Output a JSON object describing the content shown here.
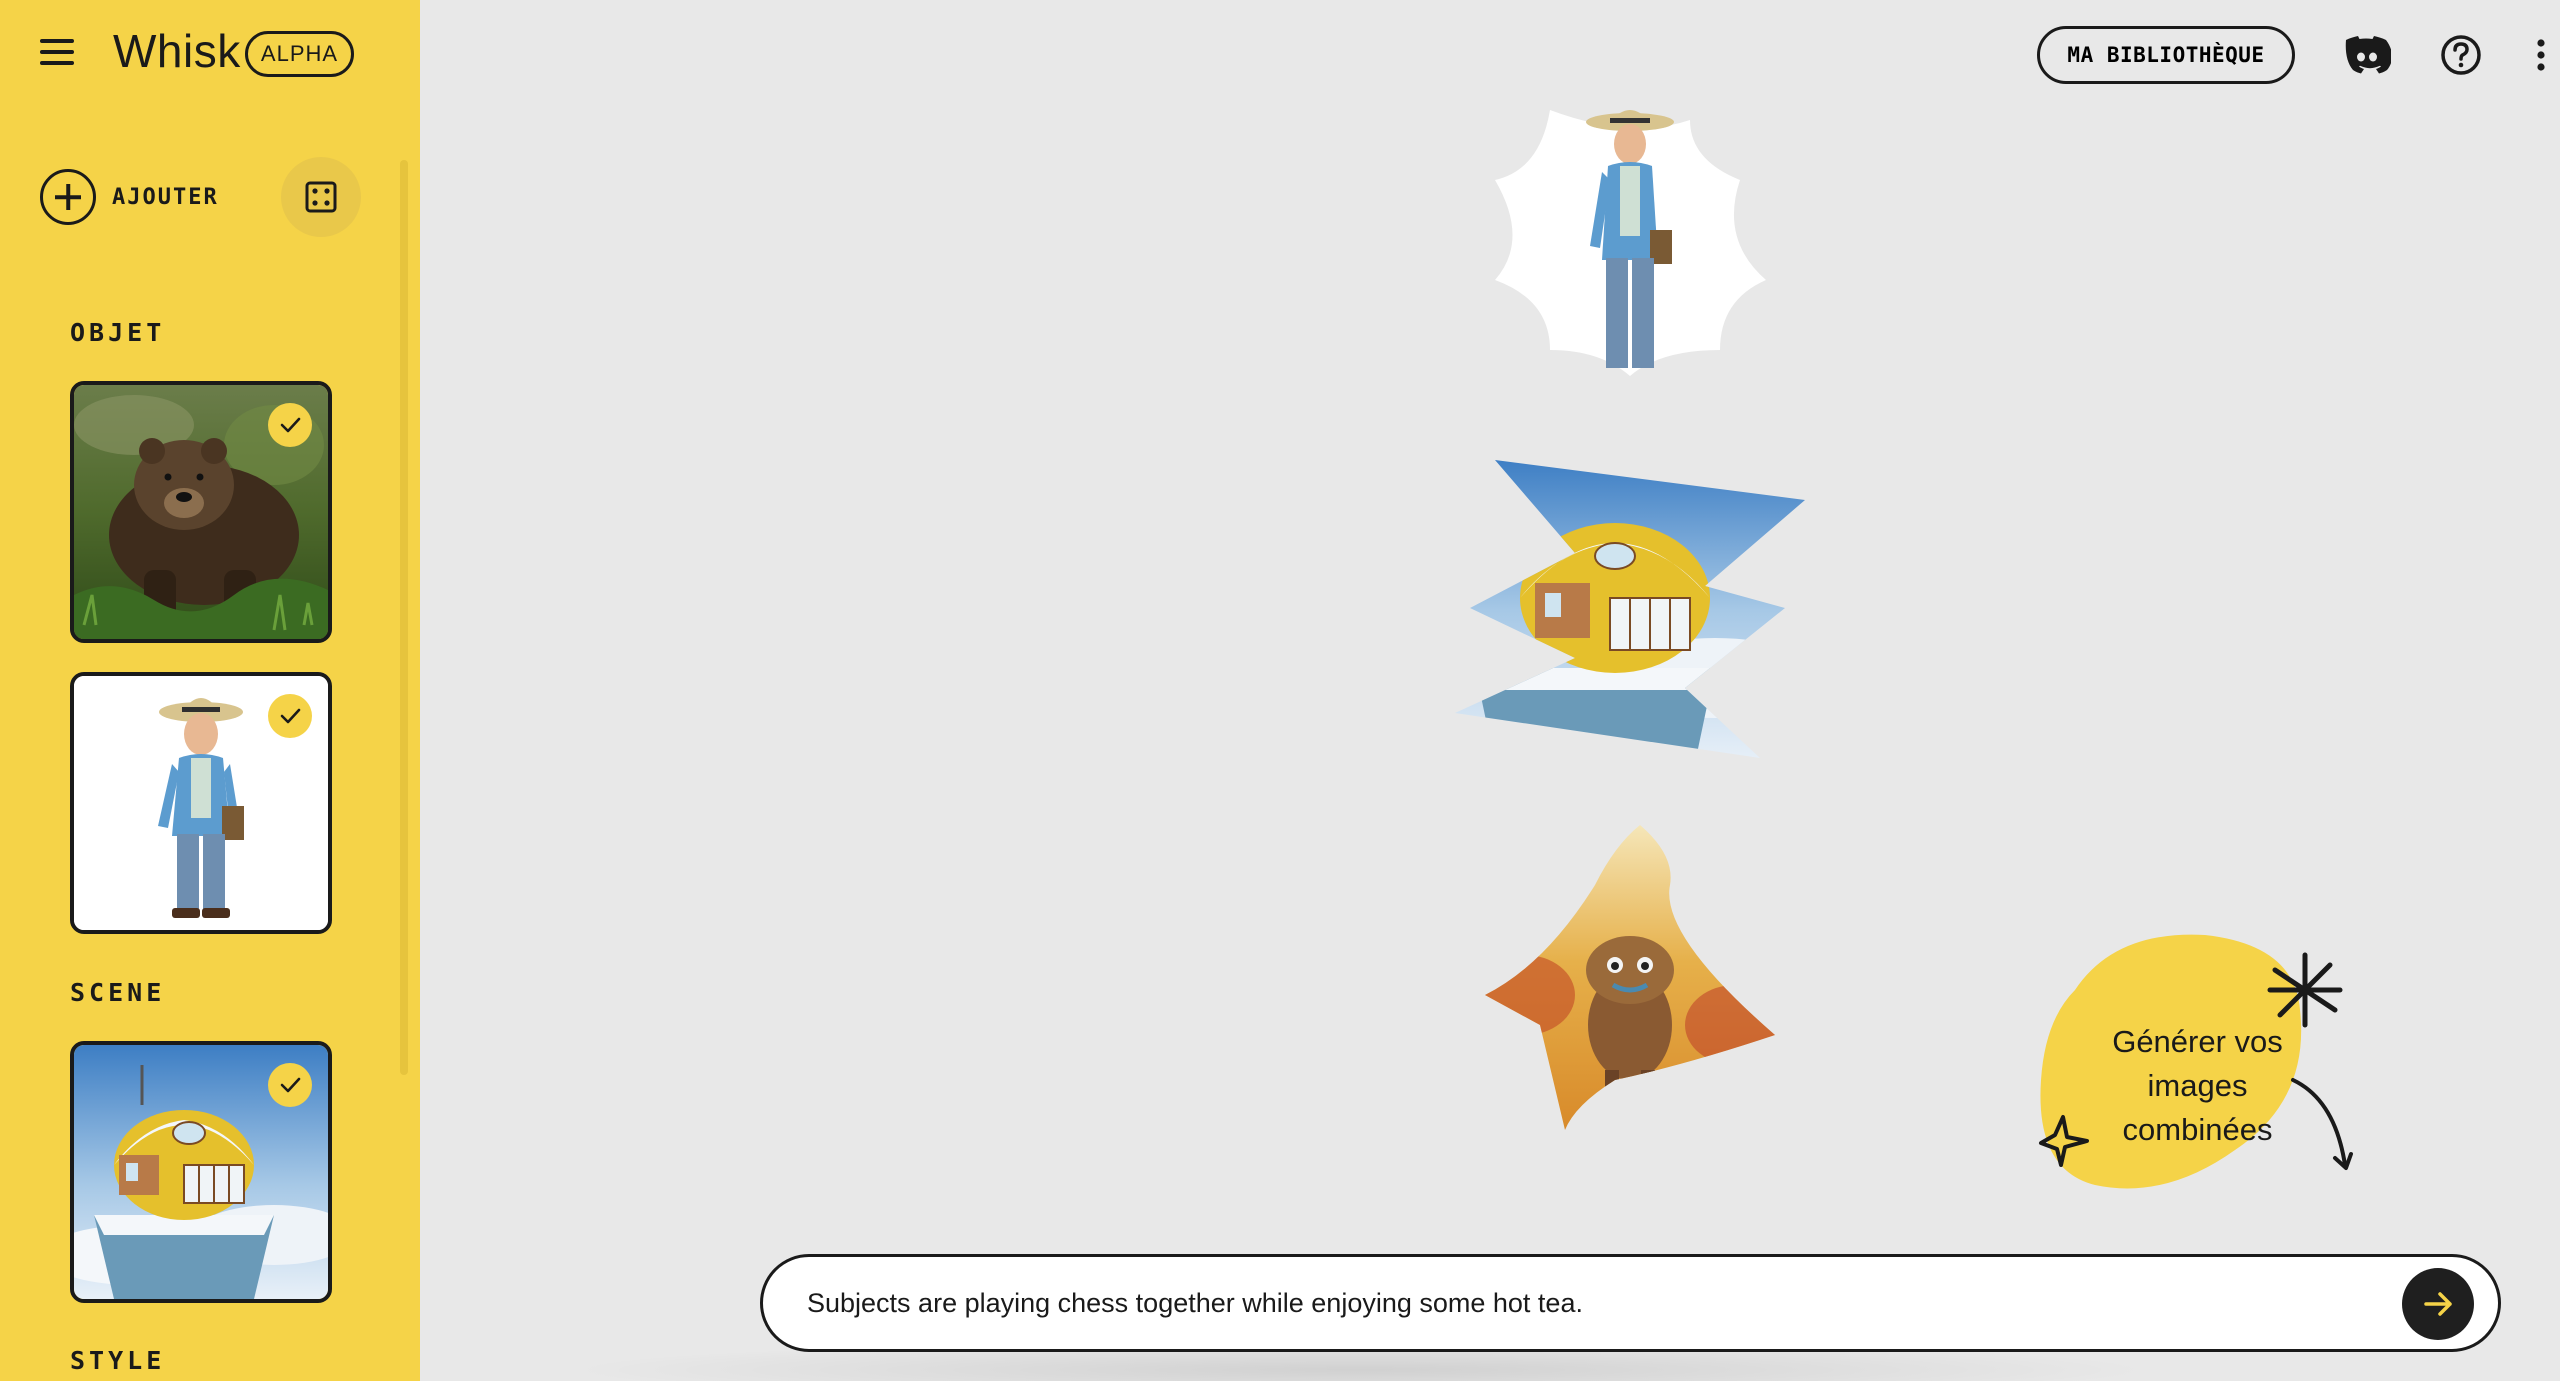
{
  "app": {
    "name": "Whisk",
    "badge": "ALPHA"
  },
  "sidebar": {
    "add_label": "AJOUTER",
    "sections": {
      "object": "OBJET",
      "scene": "SCENE",
      "style": "STYLE"
    },
    "object_items": [
      {
        "icon": "bear-photo",
        "selected": true
      },
      {
        "icon": "old-man-photo",
        "selected": true
      }
    ],
    "scene_items": [
      {
        "icon": "igloo-house-photo",
        "selected": true
      }
    ]
  },
  "header": {
    "library_label": "MA BIBLIOTHÈQUE",
    "icons": [
      "discord-icon",
      "help-icon",
      "more-vert-icon"
    ]
  },
  "canvas": {
    "images": [
      "old-man-cutout",
      "igloo-cutout",
      "creature-cutout"
    ]
  },
  "callout": {
    "text_line1": "Générer vos",
    "text_line2": "images",
    "text_line3": "combinées"
  },
  "prompt": {
    "value": "Subjects are playing chess together while enjoying some hot tea."
  },
  "colors": {
    "sidebar": "#f5d348",
    "background": "#e8e8e8",
    "dark": "#1a1a1a"
  }
}
